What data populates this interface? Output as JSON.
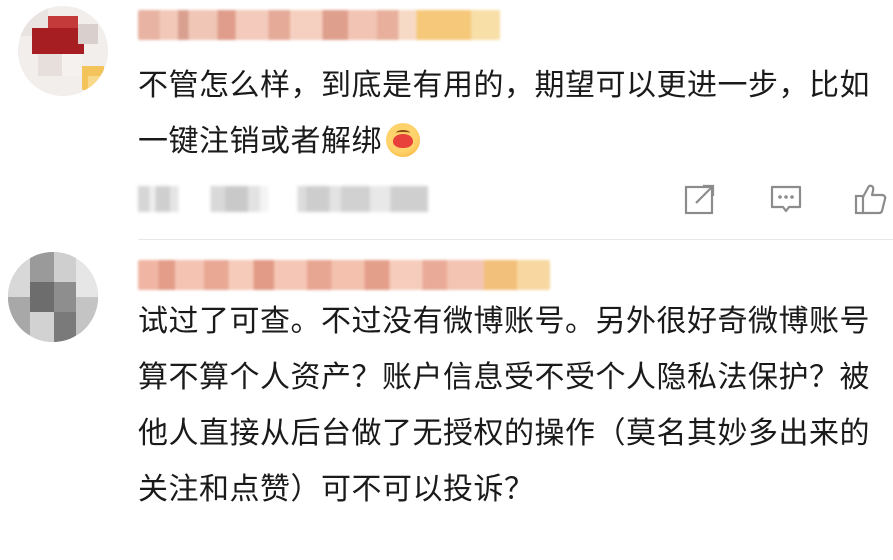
{
  "comments": [
    {
      "text": "不管怎么样，到底是有用的，期望可以更进一步，比如一键注销或者解绑",
      "emoji_icon": "kiss-face-emoji",
      "actions": [
        "share-icon",
        "comment-icon",
        "like-thumb-icon"
      ]
    },
    {
      "text": "试过了可查。不过没有微博账号。另外很好奇微博账号算不算个人资产？账户信息受不受个人隐私法保护？被他人直接从后台做了无授权的操作（莫名其妙多出来的关注和点赞）可不可以投诉？"
    }
  ],
  "colors": {
    "text": "#1a1a1a",
    "icon": "#8c8c8c",
    "divider": "#e8e8e8"
  }
}
